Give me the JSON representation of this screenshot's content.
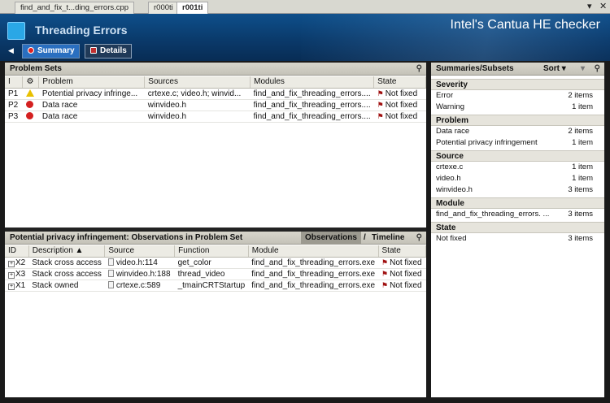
{
  "tabs": [
    {
      "label": "find_and_fix_t...ding_errors.cpp",
      "active": false
    },
    {
      "label": "r000ti",
      "active": false
    },
    {
      "label": "r001ti",
      "active": true
    }
  ],
  "tabstrip": {
    "menu_icon": "dropdown-icon",
    "close_icon": "close-icon"
  },
  "header": {
    "title": "Threading Errors",
    "product": "Intel's Cantua HE checker",
    "summary_label": "Summary",
    "details_label": "Details"
  },
  "problem_sets": {
    "title": "Problem Sets",
    "columns": [
      "I",
      "",
      "Problem",
      "Sources",
      "Modules",
      "State"
    ],
    "rows": [
      {
        "id": "P1",
        "severity": "warning",
        "problem": "Potential privacy infringe...",
        "sources": "crtexe.c; video.h; winvid...",
        "modules": "find_and_fix_threading_errors....",
        "state": "Not fixed"
      },
      {
        "id": "P2",
        "severity": "error",
        "problem": "Data race",
        "sources": "winvideo.h",
        "modules": "find_and_fix_threading_errors....",
        "state": "Not fixed"
      },
      {
        "id": "P3",
        "severity": "error",
        "problem": "Data race",
        "sources": "winvideo.h",
        "modules": "find_and_fix_threading_errors....",
        "state": "Not fixed"
      }
    ]
  },
  "observations": {
    "title": "Potential privacy infringement: Observations in Problem Set",
    "tab_observations": "Observations",
    "tab_separator": "/",
    "tab_timeline": "Timeline",
    "columns": [
      "ID",
      "Description ▲",
      "Source",
      "Function",
      "Module",
      "State"
    ],
    "rows": [
      {
        "id": "X2",
        "description": "Stack cross access",
        "source": "video.h:114",
        "function": "get_color",
        "module": "find_and_fix_threading_errors.exe",
        "state": "Not fixed"
      },
      {
        "id": "X3",
        "description": "Stack cross access",
        "source": "winvideo.h:188",
        "function": "thread_video",
        "module": "find_and_fix_threading_errors.exe",
        "state": "Not fixed"
      },
      {
        "id": "X1",
        "description": "Stack owned",
        "source": "crtexe.c:589",
        "function": "_tmainCRTStartup",
        "module": "find_and_fix_threading_errors.exe",
        "state": "Not fixed"
      }
    ]
  },
  "summaries": {
    "title": "Summaries/Subsets",
    "sort_label": "Sort ▾",
    "sections": [
      {
        "name": "Severity",
        "items": [
          {
            "label": "Error",
            "count": "2 items"
          },
          {
            "label": "Warning",
            "count": "1 item"
          }
        ]
      },
      {
        "name": "Problem",
        "items": [
          {
            "label": "Data race",
            "count": "2 items"
          },
          {
            "label": "Potential privacy infringement",
            "count": "1 item"
          }
        ]
      },
      {
        "name": "Source",
        "items": [
          {
            "label": "crtexe.c",
            "count": "1 item"
          },
          {
            "label": "video.h",
            "count": "1 item"
          },
          {
            "label": "winvideo.h",
            "count": "3 items"
          }
        ]
      },
      {
        "name": "Module",
        "items": [
          {
            "label": "find_and_fix_threading_errors. ...",
            "count": "3 items"
          }
        ]
      },
      {
        "name": "State",
        "items": [
          {
            "label": "Not fixed",
            "count": "3 items"
          }
        ]
      }
    ]
  },
  "colors": {
    "banner": "#0a3a6b",
    "accent": "#2a6fc0",
    "error": "#d42020",
    "warning": "#e8c000"
  }
}
